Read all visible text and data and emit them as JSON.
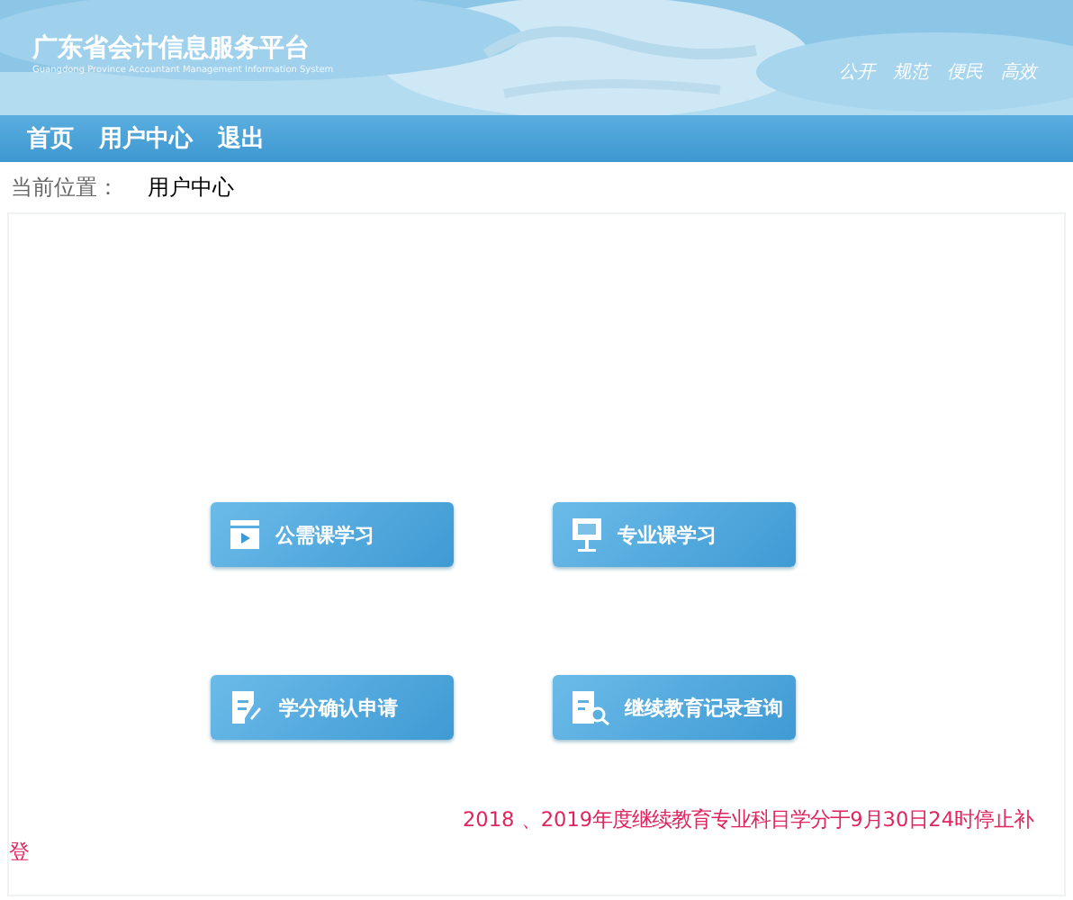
{
  "header": {
    "title": "广东省会计信息服务平台",
    "subtitle": "Guangdong Province Accountant Management Information System",
    "slogans": [
      "公开",
      "规范",
      "便民",
      "高效"
    ]
  },
  "nav": {
    "items": [
      "首页",
      "用户中心",
      "退出"
    ]
  },
  "breadcrumb": {
    "label": "当前位置：",
    "current": "用户中心"
  },
  "actions": [
    {
      "label": "公需课学习",
      "kind": "video"
    },
    {
      "label": "专业课学习",
      "kind": "board"
    },
    {
      "label": "学分确认申请",
      "kind": "form"
    },
    {
      "label": "继续教育记录查询",
      "kind": "search"
    }
  ],
  "notice": "2018 、2019年度继续教育专业科目学分于9月30日24时停止补登"
}
